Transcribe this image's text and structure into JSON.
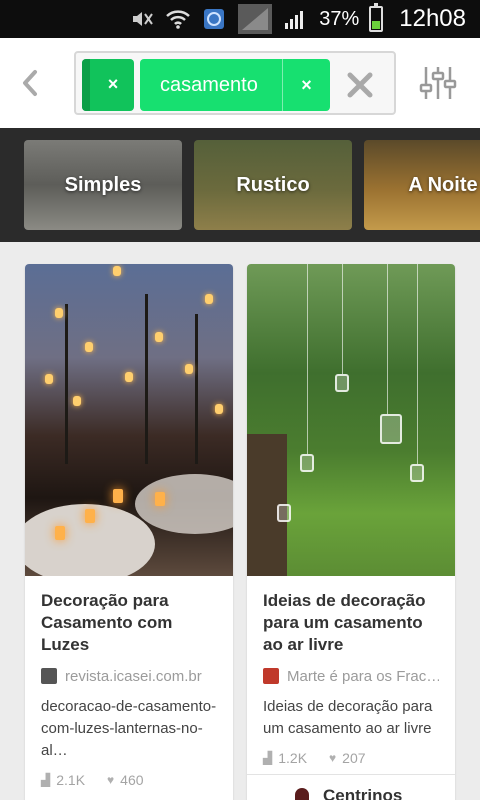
{
  "status_bar": {
    "icons": [
      "mute-icon",
      "wifi-icon",
      "sync-icon",
      "no-signal-icon",
      "signal-icon"
    ],
    "battery_percent": "37%",
    "battery_level": 0.37,
    "time": "12h08"
  },
  "search": {
    "chips": [
      {
        "label": "",
        "remove": "×"
      },
      {
        "label": "casamento",
        "remove": "×"
      }
    ],
    "accent_color": "#17e070"
  },
  "categories": [
    {
      "label": "Simples"
    },
    {
      "label": "Rustico"
    },
    {
      "label": "A Noite"
    }
  ],
  "cards": [
    {
      "title": "Decoração para Casamento com Luzes",
      "source": "revista.icasei.com.br",
      "description": "decoracao-de-casamento-com-luzes-lanternas-no-al…",
      "repins": "2.1K",
      "likes": "460"
    },
    {
      "title": "Ideias de decoração para um casamento ao ar livre",
      "source": "Marte é para os Frac…",
      "description": "Ideias de decoração para um casamento ao ar livre",
      "repins": "1.2K",
      "likes": "207",
      "peek_text": "Centrinos"
    }
  ]
}
